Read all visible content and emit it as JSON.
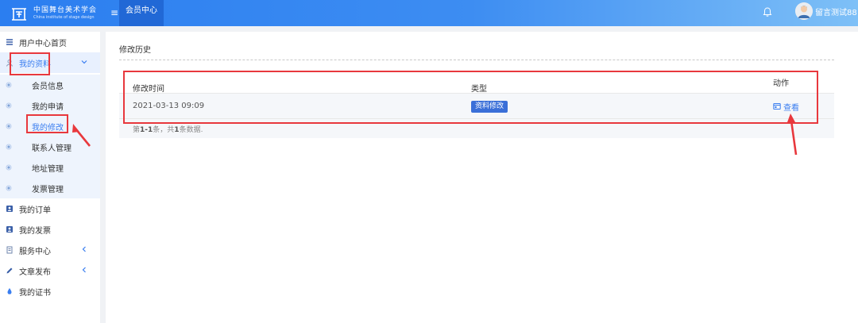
{
  "header": {
    "logo_cn": "中国舞台美术学会",
    "logo_en": "China institute of stage design",
    "active_tab": "会员中心",
    "username": "留言测试88"
  },
  "sidebar": {
    "items": [
      {
        "label": "用户中心首页",
        "icon": "menu-icon"
      },
      {
        "label": "我的资料",
        "icon": "user-profile-icon",
        "expanded": true
      },
      {
        "label": "我的订单",
        "icon": "order-icon"
      },
      {
        "label": "我的发票",
        "icon": "invoice-icon"
      },
      {
        "label": "服务中心",
        "icon": "service-icon"
      },
      {
        "label": "文章发布",
        "icon": "pencil-icon"
      },
      {
        "label": "我的证书",
        "icon": "certificate-icon"
      }
    ],
    "sub_items": [
      {
        "label": "会员信息"
      },
      {
        "label": "我的申请"
      },
      {
        "label": "我的修改",
        "active": true
      },
      {
        "label": "联系人管理"
      },
      {
        "label": "地址管理"
      },
      {
        "label": "发票管理"
      }
    ]
  },
  "main": {
    "title": "修改历史",
    "table": {
      "columns": [
        "修改时间",
        "类型",
        "动作"
      ],
      "rows": [
        {
          "time": "2021-03-13 09:09",
          "type": "资料修改",
          "action": "查看"
        }
      ]
    },
    "summary": {
      "prefix": "第",
      "range": "1-1",
      "middle": "条，共",
      "total": "1",
      "suffix": "条数据."
    }
  },
  "colors": {
    "accent": "#3a7ef0",
    "topbar": "#2b7ef0",
    "badge": "#3a6fd8",
    "annotation": "#e8383d"
  }
}
